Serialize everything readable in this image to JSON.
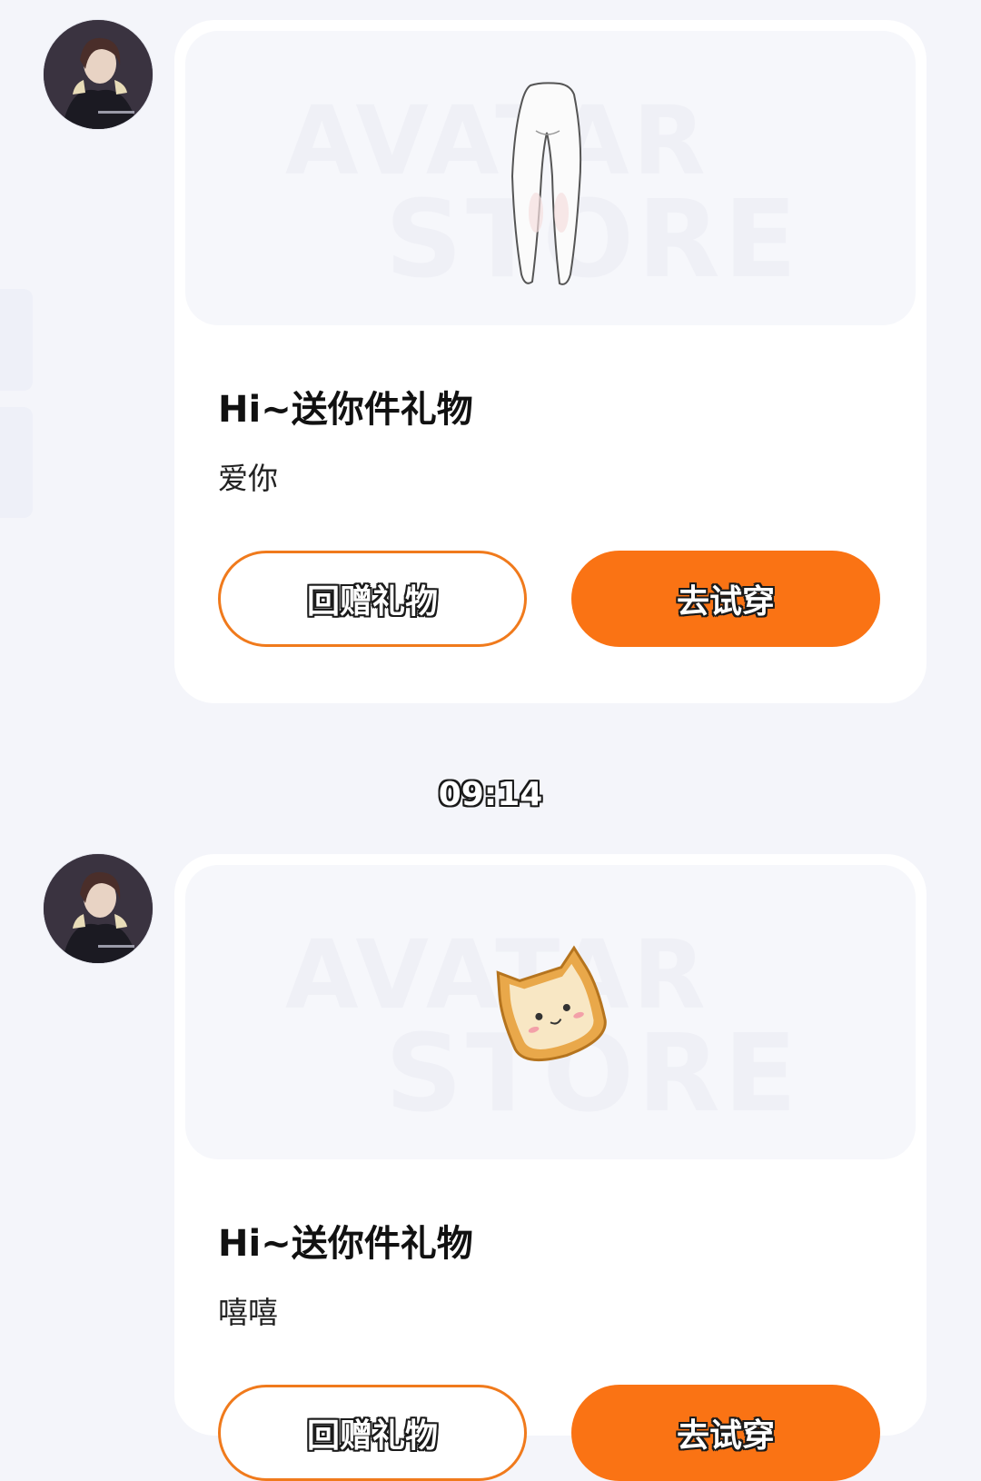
{
  "watermark": {
    "line1": "AVATAR",
    "line2": "STORE"
  },
  "messages": [
    {
      "title": "Hi~送你件礼物",
      "text": "爱你",
      "gift_icon": "white-leggings-icon",
      "return_gift_label": "回赠礼物",
      "try_on_label": "去试穿"
    },
    {
      "title": "Hi~送你件礼物",
      "text": "嘻嘻",
      "gift_icon": "cat-toast-icon",
      "return_gift_label": "回赠礼物",
      "try_on_label": "去试穿"
    }
  ],
  "timestamp": "09:14",
  "colors": {
    "accent": "#fa7314",
    "outline": "#f07a1c",
    "background": "#f4f5fa",
    "card": "#ffffff"
  }
}
